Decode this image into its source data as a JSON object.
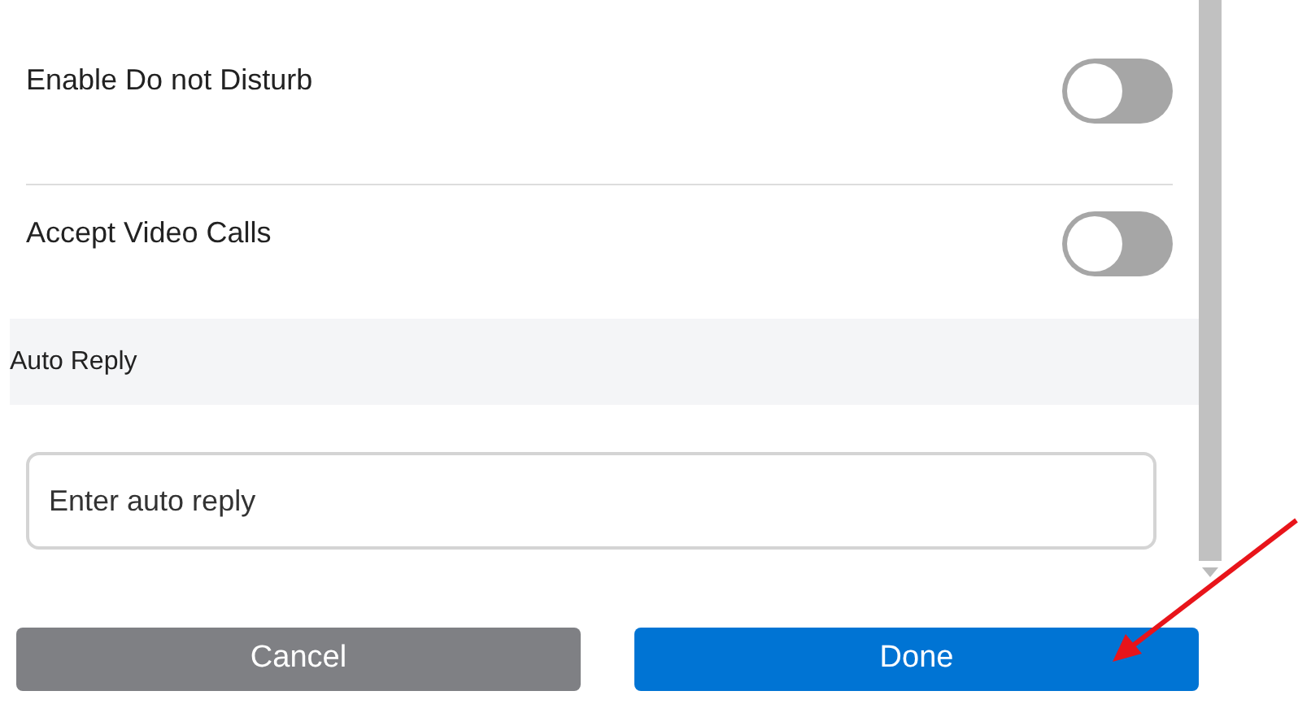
{
  "settings": [
    {
      "label": "Enable Do not Disturb",
      "on": false
    },
    {
      "label": "Accept Video Calls",
      "on": false
    }
  ],
  "auto_reply": {
    "heading": "Auto Reply",
    "placeholder": "Enter auto reply"
  },
  "buttons": [
    {
      "label": "Cancel",
      "kind": "secondary"
    },
    {
      "label": "Done",
      "kind": "primary"
    }
  ]
}
